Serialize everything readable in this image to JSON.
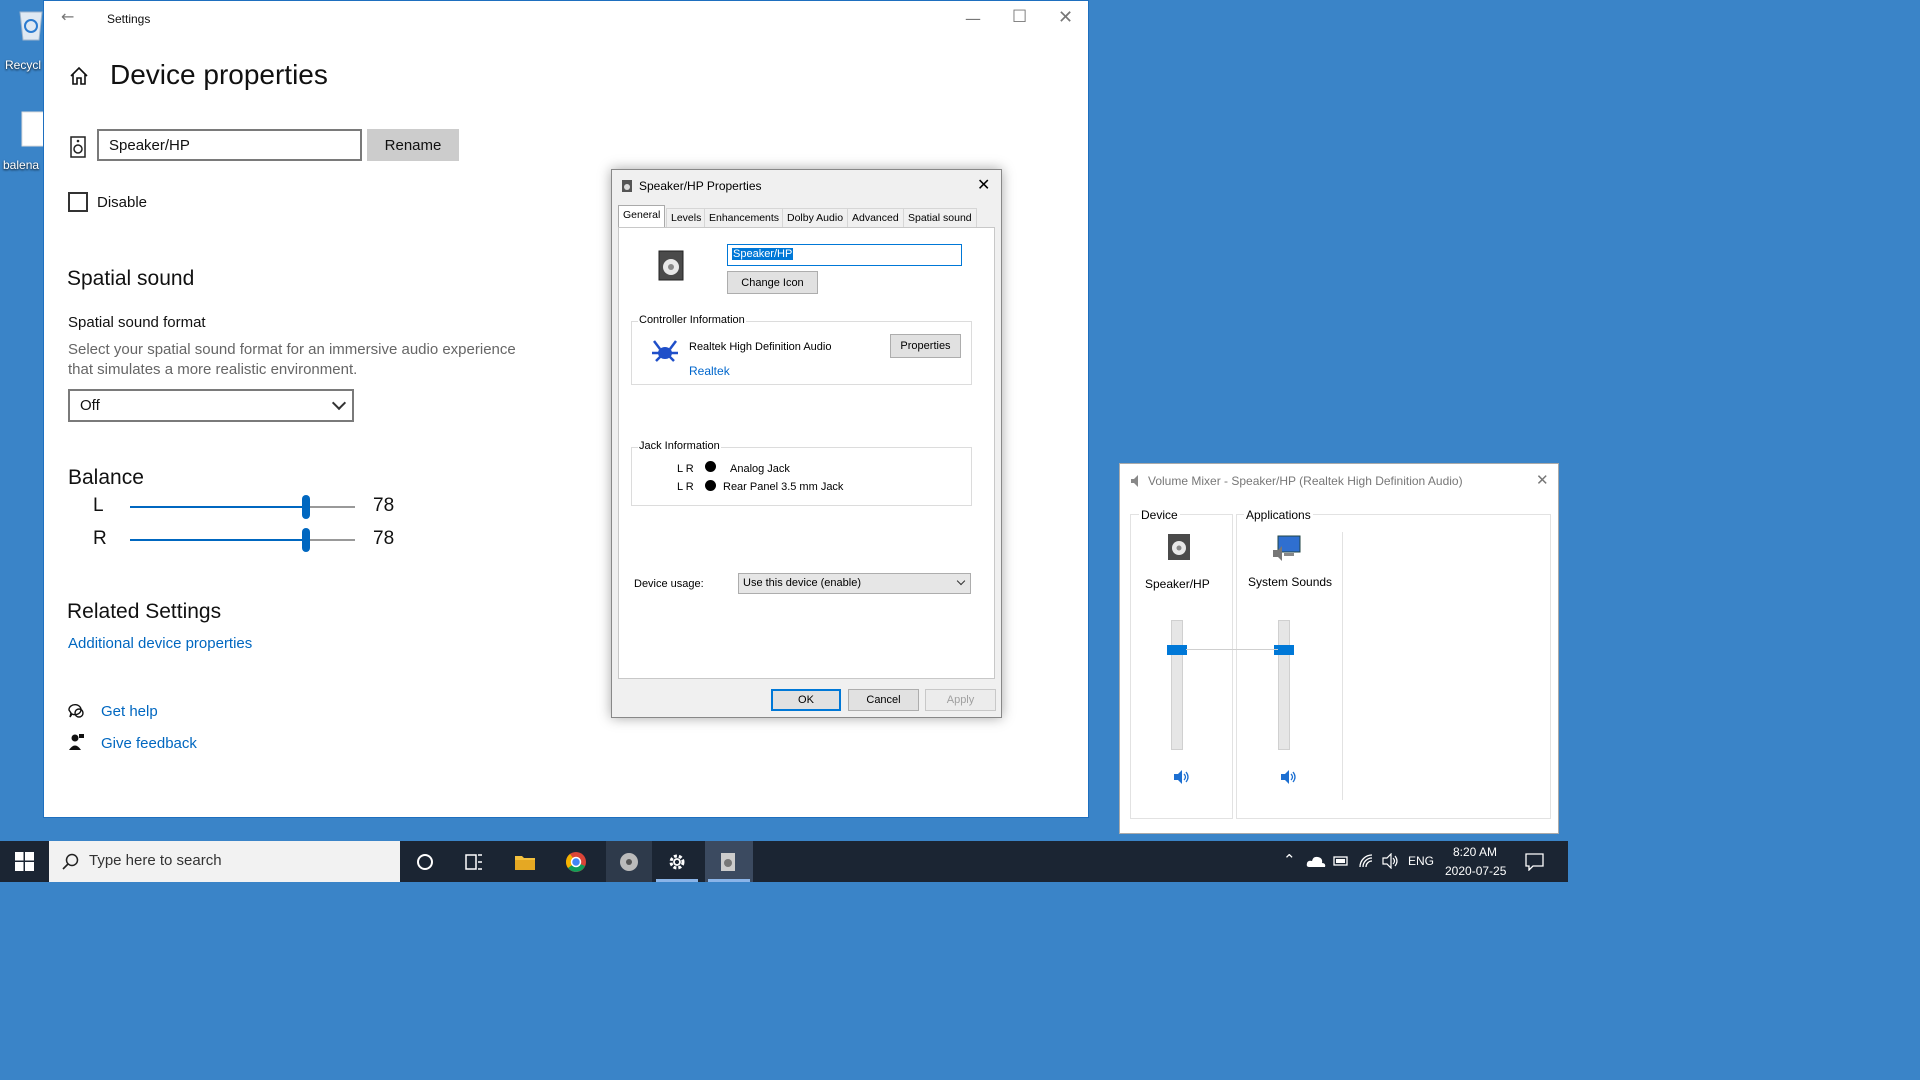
{
  "desktop": {
    "icons": [
      {
        "label": "Recycl",
        "icon": "recycle-bin-icon"
      },
      {
        "label": "balena",
        "icon": "file-icon"
      }
    ]
  },
  "settings": {
    "window_title": "Settings",
    "page_title": "Device properties",
    "device_name": "Speaker/HP",
    "rename_label": "Rename",
    "disable_label": "Disable",
    "spatial": {
      "heading": "Spatial sound",
      "format_label": "Spatial sound format",
      "description": "Select your spatial sound format for an immersive audio experience that simulates a more realistic environment.",
      "format_value": "Off"
    },
    "balance": {
      "heading": "Balance",
      "channels": [
        {
          "label": "L",
          "value": "78",
          "level": 0.78
        },
        {
          "label": "R",
          "value": "78",
          "level": 0.78
        }
      ]
    },
    "related": {
      "heading": "Related Settings",
      "link": "Additional device properties"
    },
    "help_label": "Get help",
    "feedback_label": "Give feedback"
  },
  "dialog": {
    "title": "Speaker/HP Properties",
    "tabs": [
      "General",
      "Levels",
      "Enhancements",
      "Dolby Audio",
      "Advanced",
      "Spatial sound"
    ],
    "active_tab": "General",
    "name_value": "Speaker/HP",
    "change_icon_label": "Change Icon",
    "controller": {
      "group_title": "Controller Information",
      "name": "Realtek High Definition Audio",
      "vendor_link": "Realtek",
      "properties_label": "Properties"
    },
    "jack": {
      "group_title": "Jack Information",
      "rows": [
        {
          "lr": "L R",
          "name": "Analog Jack"
        },
        {
          "lr": "L R",
          "name": "Rear Panel 3.5 mm Jack"
        }
      ]
    },
    "usage_label": "Device usage:",
    "usage_value": "Use this device (enable)",
    "ok_label": "OK",
    "cancel_label": "Cancel",
    "apply_label": "Apply"
  },
  "mixer": {
    "title": "Volume Mixer - Speaker/HP (Realtek High Definition Audio)",
    "device_heading": "Device",
    "apps_heading": "Applications",
    "device_name": "Speaker/HP",
    "app_name": "System Sounds",
    "device_level": 0.78,
    "app_level": 0.78
  },
  "taskbar": {
    "search_placeholder": "Type here to search",
    "language": "ENG",
    "time": "8:20 AM",
    "date": "2020-07-25"
  },
  "colors": {
    "accent": "#0067c0",
    "desktop": "#3a84c8",
    "taskbar": "#1b2533"
  }
}
